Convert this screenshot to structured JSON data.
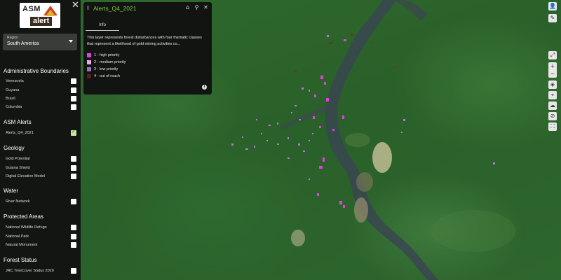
{
  "app": {
    "logo_line1": "ASM",
    "logo_line2": "alert",
    "close_glyph": "✕"
  },
  "region": {
    "label": "Region",
    "value": "South America"
  },
  "sections": [
    {
      "title": "Administrative Boundaries",
      "items": [
        {
          "label": "Venezuela",
          "checked": false
        },
        {
          "label": "Guyana",
          "checked": false
        },
        {
          "label": "Brazil",
          "checked": false
        },
        {
          "label": "Columbia",
          "checked": false
        }
      ]
    },
    {
      "title": "ASM Alerts",
      "items": [
        {
          "label": "Alerts_Q4_2021",
          "checked": true
        }
      ]
    },
    {
      "title": "Geology",
      "items": [
        {
          "label": "Gold Potential",
          "checked": false
        },
        {
          "label": "Guiana Shield",
          "checked": false
        },
        {
          "label": "Digital Elevation Model",
          "checked": false
        }
      ]
    },
    {
      "title": "Water",
      "items": [
        {
          "label": "River Network",
          "checked": false
        }
      ]
    },
    {
      "title": "Protected Areas",
      "items": [
        {
          "label": "National Wildlife Refuge",
          "checked": false
        },
        {
          "label": "National Park",
          "checked": false
        },
        {
          "label": "Natural Monument",
          "checked": false
        }
      ]
    },
    {
      "title": "Forest Status",
      "items": [
        {
          "label": "JRC TreeCover Status 2020",
          "checked": false
        }
      ]
    }
  ],
  "info_panel": {
    "title": "Alerts_Q4_2021",
    "tab": "Info",
    "description": "This layer represents forest disturbances with four thematic classes that represent a likelihood of gold mining activities co...",
    "legend": [
      {
        "label": "1 - high priority",
        "color": "#e040e0"
      },
      {
        "label": "2 - medium priority",
        "color": "#e8a6ec"
      },
      {
        "label": "3 - low priority",
        "color": "#9a6fc8"
      },
      {
        "label": "4 - out of reach",
        "color": "#5a1e1e"
      }
    ],
    "icons": [
      "home-icon",
      "zoom-to-layer-icon",
      "close-icon"
    ],
    "info_button": "i"
  },
  "toolbar": {
    "icons": [
      "user-icon",
      "edit-icon",
      "fullscreen-icon",
      "zoom-in-icon",
      "zoom-out-icon",
      "layers-icon",
      "location-icon",
      "cloud-upload-icon",
      "block-icon",
      "crop-icon"
    ]
  }
}
